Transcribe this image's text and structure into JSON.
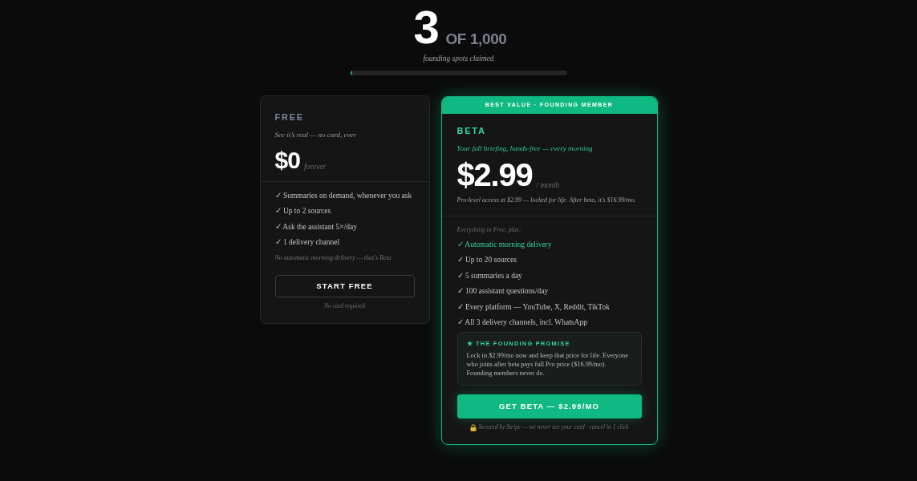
{
  "counter": {
    "claimed": "3",
    "total": "OF 1,000",
    "caption": "founding spots claimed",
    "level": 0.003
  },
  "plans": [
    {
      "kind": "free",
      "name": "FREE",
      "tagline": "See it’s real — no card, ever",
      "price": "$0",
      "period": "forever",
      "features": [
        {
          "label": "✓ Summaries on demand, whenever you ask",
          "highlighted": false
        },
        {
          "label": "✓ Up to 2 sources",
          "highlighted": false
        },
        {
          "label": "✓ Ask the assistant 5×/day",
          "highlighted": false
        },
        {
          "label": "✓ 1 delivery channel",
          "highlighted": false
        }
      ],
      "note": "No automatic morning delivery — that’s Beta",
      "button": "START FREE",
      "footnote": "No card required"
    },
    {
      "kind": "beta",
      "badge": "BEST VALUE · FOUNDING MEMBER",
      "name": "BETA",
      "tagline": "Your full briefing, hands-free — every morning",
      "price": "$2.99",
      "period": "/ month",
      "price_note": "Pro-level access at $2.99 — locked for life. After beta, it’s $16.99/mo.",
      "features_intro": "Everything in Free, plus:",
      "features": [
        {
          "label": "✓ Automatic morning delivery",
          "highlighted": true
        },
        {
          "label": "✓ Up to 20 sources",
          "highlighted": false
        },
        {
          "label": "✓ 5 summaries a day",
          "highlighted": false
        },
        {
          "label": "✓ 100 assistant questions/day",
          "highlighted": false
        },
        {
          "label": "✓ Every platform — YouTube, X, Reddit, TikTok",
          "highlighted": false
        },
        {
          "label": "✓ All 3 delivery channels, incl. WhatsApp",
          "highlighted": false
        }
      ],
      "promise": {
        "title": "★ THE FOUNDING PROMISE",
        "text": "Lock in $2.99/mo now and keep that price for life. Everyone who joins after beta pays full Pro price ($16.99/mo). Founding members never do."
      },
      "button": "GET BETA — $2.99/MO",
      "footnote": "Secured by Stripe — we never see your card · cancel in 1 click"
    }
  ]
}
